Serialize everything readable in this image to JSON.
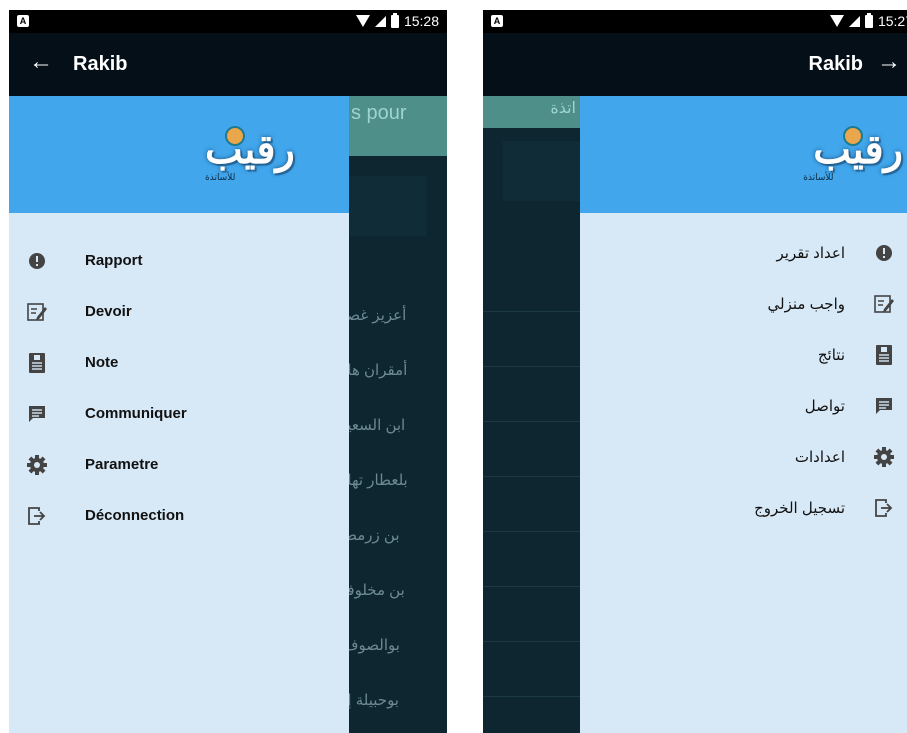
{
  "left_screen": {
    "status": {
      "time": "15:28"
    },
    "appbar": {
      "back_icon": "arrow-left-icon",
      "title": "Rakib"
    },
    "background": {
      "header_text": "s pour",
      "names": [
        "أعزيز غصـ",
        "أمقران هاـ",
        "ابن السعيـ",
        "بلعطار تهاـ",
        "بن زرمط",
        "بن مخلوفـ",
        "بوالصوف",
        "بوحبيلة إـ"
      ]
    },
    "drawer": {
      "logo_text": "رقيب",
      "logo_subtitle": "للأساتذة",
      "items": [
        {
          "icon": "alert-icon",
          "label": "Rapport"
        },
        {
          "icon": "edit-note-icon",
          "label": "Devoir"
        },
        {
          "icon": "grade-sheet-icon",
          "label": "Note"
        },
        {
          "icon": "message-icon",
          "label": "Communiquer"
        },
        {
          "icon": "gear-icon",
          "label": "Parametre"
        },
        {
          "icon": "logout-icon",
          "label": "Déconnection"
        }
      ]
    }
  },
  "right_screen": {
    "status": {
      "time": "15:27"
    },
    "appbar": {
      "back_icon": "arrow-right-icon",
      "title": "Rakib"
    },
    "background": {
      "header_text": "اتذة"
    },
    "drawer": {
      "logo_text": "رقيب",
      "logo_subtitle": "للأساتذة",
      "items": [
        {
          "icon": "alert-icon",
          "label": "اعداد تقرير"
        },
        {
          "icon": "edit-note-icon",
          "label": "واجب منزلي"
        },
        {
          "icon": "grade-sheet-icon",
          "label": "نتائج"
        },
        {
          "icon": "message-icon",
          "label": "تواصل"
        },
        {
          "icon": "gear-icon",
          "label": "اعدادات"
        },
        {
          "icon": "logout-icon",
          "label": "تسجيل الخروج"
        }
      ]
    }
  },
  "colors": {
    "status_bar": "#000000",
    "app_bar": "#040f18",
    "drawer_header": "#41a6ec",
    "drawer_body": "#d7e8f6",
    "icon": "#444444",
    "overlay": "#0d2630"
  }
}
